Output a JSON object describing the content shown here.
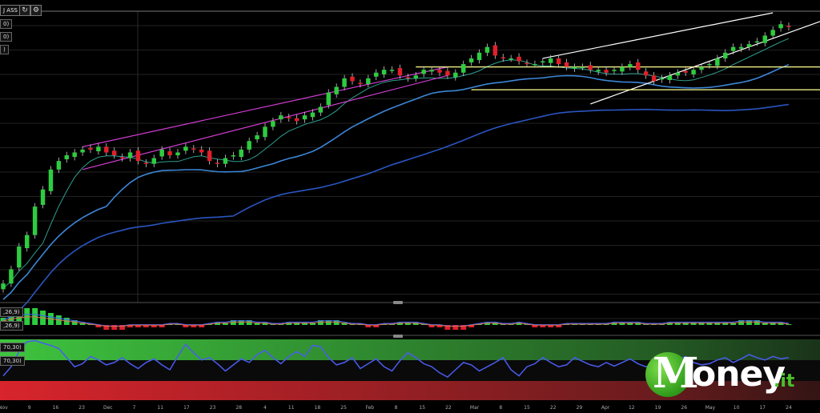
{
  "header": {
    "instrument_label": "J ASS",
    "refresh_icon": "refresh-icon",
    "settings_icon": "settings-icon"
  },
  "indicator_tags": {
    "main": [
      "0)",
      "0)",
      ")"
    ],
    "macd": [
      ",26,9)",
      ",26,9)"
    ],
    "rsi": [
      "70,30)",
      "70,30)"
    ]
  },
  "logo": {
    "mark": "M",
    "word": "oney",
    "tld": ".it"
  },
  "colors": {
    "background": "#000000",
    "candle_up": "#2ecc40",
    "candle_down": "#e0202a",
    "channel_magenta": "#d23cd2",
    "channel_white": "#ffffff",
    "range_yellow": "#ffff90",
    "ma_fast": "#2f9e8f",
    "ma_mid": "#3d86d6",
    "ma_slow": "#2a55c0",
    "rsi_line": "#4a5cf0",
    "rsi_upper_band": "#3ec43e",
    "rsi_lower_band": "#d8242c",
    "logo_green": "#49c22a"
  },
  "chart_data": [
    {
      "type": "candlestick",
      "panel": "price",
      "title": "",
      "xlabel": "",
      "ylabel": "",
      "x_ticks": [
        "Nov",
        "9",
        "16",
        "23",
        "Dec",
        "7",
        "11",
        "17",
        "23",
        "28",
        "4",
        "11",
        "18",
        "25",
        "Feb",
        "8",
        "15",
        "22",
        "Mar",
        "8",
        "15",
        "22",
        "29",
        "Apr",
        "12",
        "19",
        "26",
        "May",
        "10",
        "17",
        "24"
      ],
      "y_range": [
        0,
        100
      ],
      "grid": true,
      "closes": [
        5,
        10,
        18,
        22,
        32,
        38,
        45,
        48,
        50,
        51,
        52,
        52,
        53,
        51,
        50,
        49,
        51,
        48,
        47,
        49,
        52,
        50,
        51,
        53,
        52,
        51,
        48,
        47,
        49,
        50,
        52,
        55,
        57,
        60,
        62,
        64,
        63,
        62,
        64,
        65,
        67,
        72,
        74,
        77,
        76,
        75,
        77,
        79,
        80,
        80,
        78,
        77,
        78,
        80,
        80,
        79,
        78,
        79,
        82,
        84,
        86,
        88,
        85,
        84,
        84,
        83,
        82,
        82,
        83,
        84,
        82,
        81,
        81,
        81,
        80,
        80,
        79,
        80,
        81,
        82,
        80,
        78,
        76,
        77,
        78,
        79,
        79,
        80,
        81,
        82,
        84,
        86,
        88,
        88,
        89,
        90,
        92,
        94,
        96,
        95
      ],
      "overlays": [
        {
          "kind": "trend-channel",
          "color": "magenta"
        },
        {
          "kind": "trend-channel",
          "color": "white"
        },
        {
          "kind": "horizontal-range",
          "color": "yellow"
        },
        {
          "kind": "moving-average",
          "color": "teal"
        },
        {
          "kind": "moving-average",
          "color": "blue"
        },
        {
          "kind": "moving-average",
          "color": "navy"
        }
      ]
    },
    {
      "type": "bar",
      "panel": "macd-histogram",
      "title": "",
      "values": [
        3,
        5,
        6,
        7,
        7,
        6,
        5,
        4,
        3,
        2,
        1,
        0,
        -1,
        -2,
        -2,
        -2,
        -1,
        -1,
        -1,
        -1,
        -1,
        0,
        0,
        -1,
        -1,
        -1,
        0,
        1,
        1,
        2,
        2,
        2,
        1,
        1,
        0,
        0,
        1,
        1,
        1,
        1,
        2,
        2,
        2,
        1,
        0,
        0,
        -1,
        -1,
        0,
        0,
        1,
        1,
        1,
        0,
        -1,
        -1,
        -2,
        -2,
        -2,
        -1,
        0,
        1,
        1,
        0,
        0,
        1,
        0,
        -1,
        -1,
        -1,
        -1,
        0,
        0,
        0,
        0,
        0,
        0,
        1,
        1,
        1,
        1,
        0,
        0,
        0,
        1,
        1,
        1,
        1,
        1,
        1,
        1,
        1,
        1,
        2,
        2,
        2,
        1,
        1,
        1,
        0
      ],
      "ylim": [
        -8,
        8
      ]
    },
    {
      "type": "line",
      "panel": "rsi",
      "title": "",
      "series": [
        {
          "values": [
            40,
            55,
            80,
            96,
            98,
            94,
            90,
            85,
            70,
            55,
            60,
            72,
            66,
            58,
            62,
            70,
            60,
            52,
            62,
            68,
            58,
            50,
            72,
            92,
            78,
            66,
            70,
            60,
            48,
            58,
            68,
            62,
            75,
            82,
            70,
            60,
            72,
            80,
            72,
            90,
            88,
            70,
            58,
            62,
            70,
            52,
            60,
            68,
            55,
            48,
            65,
            78,
            70,
            60,
            55,
            45,
            38,
            50,
            62,
            58,
            48,
            55,
            62,
            70,
            50,
            40,
            55,
            60,
            70,
            62,
            55,
            58,
            70,
            64,
            58,
            55,
            62,
            56,
            62,
            68,
            60,
            55,
            58,
            62,
            60,
            65,
            72,
            62,
            58,
            60,
            66,
            70,
            62,
            68,
            75,
            70,
            66,
            72,
            68,
            70
          ]
        }
      ],
      "ylim": [
        0,
        100
      ],
      "bands": [
        70,
        30
      ]
    }
  ]
}
